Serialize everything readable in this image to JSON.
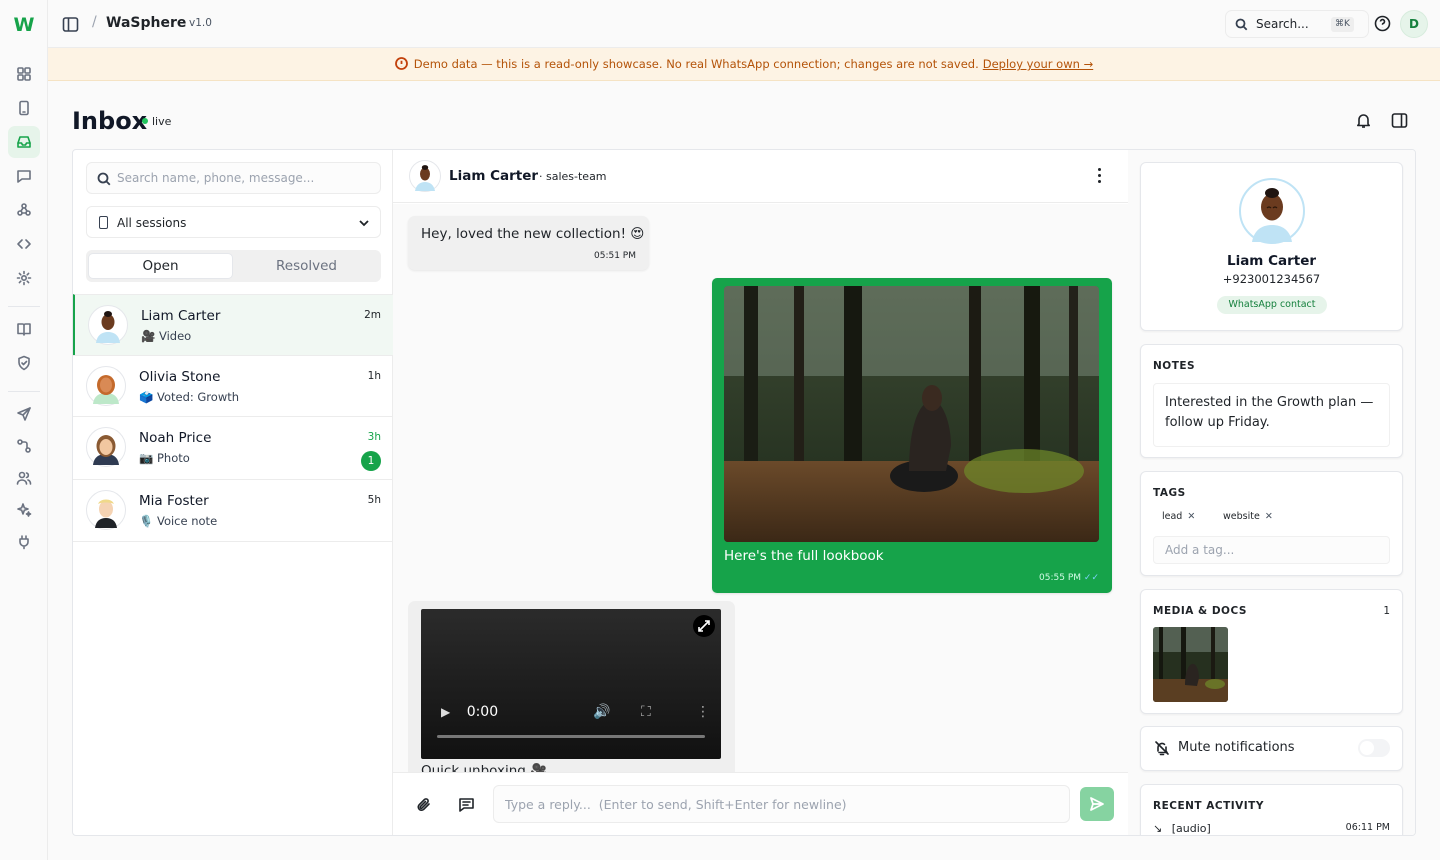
{
  "app": {
    "name": "WaSphere",
    "version": "v1.0",
    "logo_letter": "W",
    "accent": "#16a34a"
  },
  "topbar": {
    "search_label": "Search...",
    "search_kbd": "⌘K",
    "user_initial": "D"
  },
  "banner": {
    "text": "Demo data — this is a read-only showcase. No real WhatsApp connection; changes are not saved.",
    "link": "Deploy your own →",
    "color": "#b45309"
  },
  "page": {
    "title": "Inbox",
    "status": "live"
  },
  "list": {
    "search_placeholder": "Search name, phone, message...",
    "session_select": "All sessions",
    "tabs": [
      "Open",
      "Resolved"
    ],
    "active_tab": "Open",
    "conversations": [
      {
        "name": "Liam Carter",
        "preview": "🎥 Video",
        "time": "2m",
        "selected": true,
        "unread": null
      },
      {
        "name": "Olivia Stone",
        "preview": "🗳️ Voted: Growth",
        "time": "1h",
        "selected": false,
        "unread": null
      },
      {
        "name": "Noah Price",
        "preview": "📷 Photo",
        "time": "3h",
        "selected": false,
        "unread": "1"
      },
      {
        "name": "Mia Foster",
        "preview": "🎙️ Voice note",
        "time": "5h",
        "selected": false,
        "unread": null
      }
    ]
  },
  "chat": {
    "contact_name": "Liam Carter",
    "session": "· sales-team",
    "messages": [
      {
        "direction": "in",
        "type": "text",
        "text": "Hey, loved the new collection! 😍",
        "time": "05:51 PM"
      },
      {
        "direction": "out",
        "type": "image",
        "caption": "Here's the full lookbook",
        "time": "05:55 PM",
        "status": "read"
      },
      {
        "direction": "in",
        "type": "video",
        "caption": "Quick unboxing 🎥",
        "player_time": "0:00"
      }
    ],
    "reply_placeholder": "Type a reply...  (Enter to send, Shift+Enter for newline)"
  },
  "profile": {
    "name": "Liam Carter",
    "phone": "+923001234567",
    "badge": "WhatsApp contact",
    "notes_title": "NOTES",
    "notes": "Interested in the Growth plan — follow up Friday.",
    "tags_title": "TAGS",
    "tags": [
      "lead",
      "website"
    ],
    "tag_placeholder": "Add a tag...",
    "media_title": "MEDIA & DOCS",
    "media_count": "1",
    "mute_label": "Mute notifications",
    "mute_on": false,
    "activity_title": "RECENT ACTIVITY",
    "activity": [
      {
        "label": "[audio]",
        "time": "06:11 PM"
      }
    ]
  },
  "icons": {
    "rail": [
      "dashboard-icon",
      "device-icon",
      "inbox-icon",
      "chat-icon",
      "webhook-icon",
      "code-icon",
      "settings-icon",
      "book-icon",
      "shield-icon",
      "send-icon",
      "flow-icon",
      "users-icon",
      "sparkles-icon",
      "plug-icon"
    ],
    "header": [
      "bell-icon",
      "panel-icon"
    ],
    "composer": [
      "paperclip-icon",
      "template-icon",
      "send-icon"
    ]
  }
}
